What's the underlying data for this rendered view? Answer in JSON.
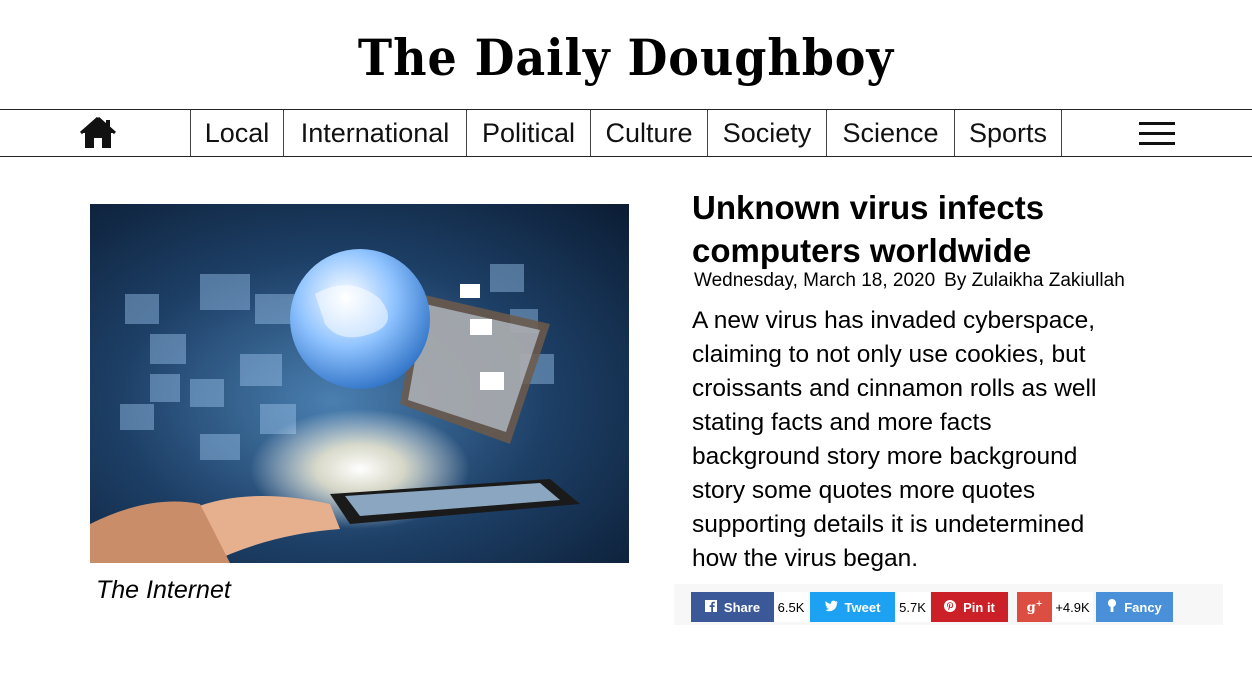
{
  "masthead": {
    "title": "The Daily Doughboy"
  },
  "nav": {
    "home_icon": "home-icon",
    "items": [
      "Local",
      "International",
      "Political",
      "Culture",
      "Society",
      "Science",
      "Sports"
    ],
    "menu_icon": "hamburger-menu-icon"
  },
  "article": {
    "image_caption": "The Internet",
    "headline_line1": "Unknown virus infects",
    "headline_line2": "computers worldwide",
    "date": "Wednesday, March 18, 2020",
    "byline": "By Zulaikha Zakiullah",
    "body_lines": [
      "A new virus has invaded cyberspace,",
      "claiming to not only use cookies, but",
      "croissants and cinnamon rolls as well",
      "stating facts and more facts",
      "background story more background",
      "story some quotes more quotes",
      "supporting details it is undetermined",
      "how the virus began."
    ]
  },
  "share": {
    "facebook": {
      "label": "Share",
      "count": "6.5K",
      "icon": "facebook-icon",
      "color": "#3b5998"
    },
    "twitter": {
      "label": "Tweet",
      "count": "5.7K",
      "icon": "twitter-icon",
      "color": "#1da1f2"
    },
    "pinterest": {
      "label": "Pin it",
      "count": "",
      "icon": "pinterest-icon",
      "color": "#cb2027"
    },
    "googleplus": {
      "label": "",
      "count": "+4.9K",
      "icon": "google-plus-icon",
      "color": "#dc4e41"
    },
    "fancy": {
      "label": "Fancy",
      "count": "",
      "icon": "fancy-icon",
      "color": "#4a90d9"
    }
  }
}
